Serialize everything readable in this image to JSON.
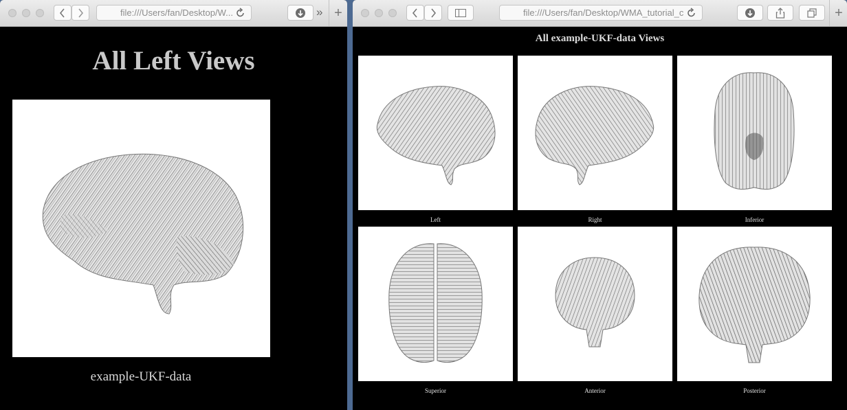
{
  "left_window": {
    "url": "file:///Users/fan/Desktop/W...",
    "title": "All Left Views",
    "caption": "example-UKF-data",
    "image": "brain-tractography-left-view"
  },
  "right_window": {
    "url": "file:///Users/fan/Desktop/WMA_tutorial_c",
    "title": "All example-UKF-data Views",
    "views": [
      {
        "label": "Left",
        "image": "brain-tractography-left"
      },
      {
        "label": "Right",
        "image": "brain-tractography-right"
      },
      {
        "label": "Inferior",
        "image": "brain-tractography-inferior"
      },
      {
        "label": "Superior",
        "image": "brain-tractography-superior"
      },
      {
        "label": "Anterior",
        "image": "brain-tractography-anterior"
      },
      {
        "label": "Posterior",
        "image": "brain-tractography-posterior"
      }
    ]
  },
  "icons": {
    "back": "chevron-left-icon",
    "forward": "chevron-right-icon",
    "reload": "reload-icon",
    "download": "download-icon",
    "more": "double-chevron-icon",
    "new_tab": "plus-icon",
    "sidebar": "sidebar-icon",
    "share": "share-icon",
    "tabs": "tabs-icon"
  },
  "colors": {
    "page_background": "#000000",
    "desktop": "#4d6a92",
    "title_text": "#c9c9c9"
  }
}
